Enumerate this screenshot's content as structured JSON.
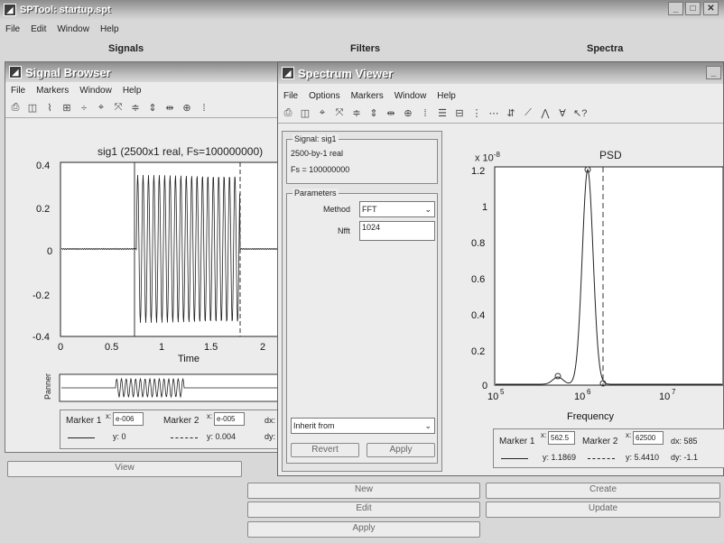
{
  "main": {
    "title": "SPTool: startup.spt",
    "menu": [
      "File",
      "Edit",
      "Window",
      "Help"
    ],
    "col_signals": "Signals",
    "col_filters": "Filters",
    "col_spectra": "Spectra",
    "buttons": {
      "view": "View",
      "new": "New",
      "edit": "Edit",
      "apply": "Apply",
      "create": "Create",
      "update": "Update"
    }
  },
  "signal_browser": {
    "title": "Signal Browser",
    "menu": [
      "File",
      "Markers",
      "Window",
      "Help"
    ],
    "plot_title": "sig1 (2500x1 real, Fs=100000000)",
    "xlabel": "Time",
    "xticks": [
      "0",
      "0.5",
      "1",
      "1.5",
      "2"
    ],
    "yticks": [
      "0.4",
      "0.2",
      "0",
      "-0.2",
      "-0.4"
    ],
    "panner_label": "Panner",
    "marker1_label": "Marker 1",
    "marker1_x": "e-006",
    "marker1_y": "y: 0",
    "marker2_label": "Marker 2",
    "marker2_x": "e-005",
    "marker2_y": "y: 0.004",
    "dx_label": "dx:",
    "dy_label": "dy:"
  },
  "spectrum_viewer": {
    "title": "Spectrum Viewer",
    "menu": [
      "File",
      "Options",
      "Markers",
      "Window",
      "Help"
    ],
    "signal_group": "Signal: sig1",
    "signal_desc": "2500-by-1 real",
    "signal_fs": "Fs = 100000000",
    "params_group": "Parameters",
    "method_label": "Method",
    "method_value": "FFT",
    "nfft_label": "Nfft",
    "nfft_value": "1024",
    "inherit_label": "Inherit from",
    "revert_label": "Revert",
    "apply_label": "Apply",
    "plot_title": "PSD",
    "exponent": "x 10",
    "exponent_power": "-8",
    "xlabel": "Frequency",
    "yticks": [
      "1.2",
      "1",
      "0.8",
      "0.6",
      "0.4",
      "0.2",
      "0"
    ],
    "xticks": [
      {
        "base": "10",
        "exp": "5"
      },
      {
        "base": "10",
        "exp": "6"
      },
      {
        "base": "10",
        "exp": "7"
      }
    ],
    "marker1_label": "Marker 1",
    "marker1_x": "562.5",
    "marker1_y": "y: 1.1869",
    "marker2_label": "Marker 2",
    "marker2_x": "62500",
    "marker2_y": "y: 5.4410",
    "dx_text": "dx: 585",
    "dy_text": "dy: -1.1"
  }
}
